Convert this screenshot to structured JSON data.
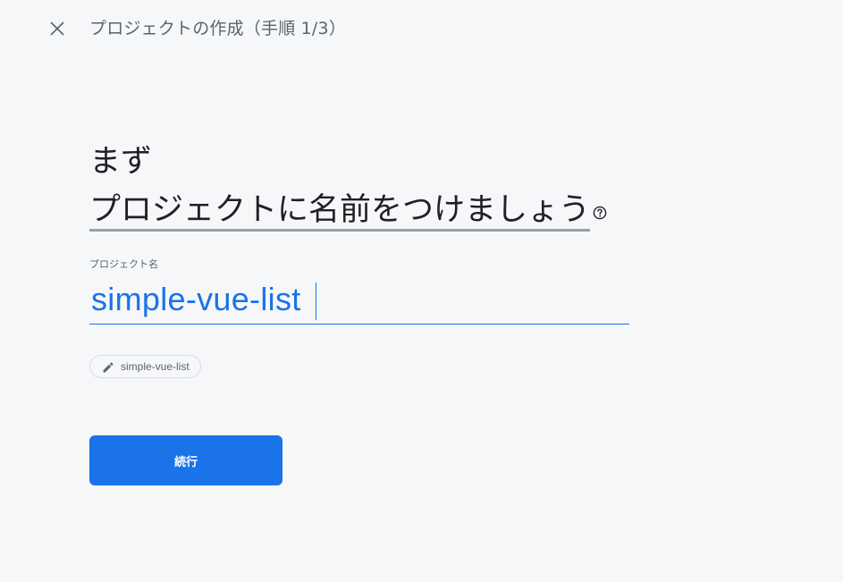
{
  "header": {
    "title": "プロジェクトの作成（手順 1/3）",
    "close_icon": "close-icon"
  },
  "heading": {
    "line1": "まず",
    "line2": "プロジェクトに名前をつけましょう",
    "help_icon": "help-circle-icon"
  },
  "project_name": {
    "label": "プロジェクト名",
    "value": "simple-vue-list"
  },
  "project_id_chip": {
    "icon": "pencil-icon",
    "text": "simple-vue-list"
  },
  "actions": {
    "continue_label": "続行"
  },
  "colors": {
    "accent": "#1a73e8",
    "background": "#f5f7f9",
    "text": "#202124",
    "muted": "#5f6368"
  }
}
